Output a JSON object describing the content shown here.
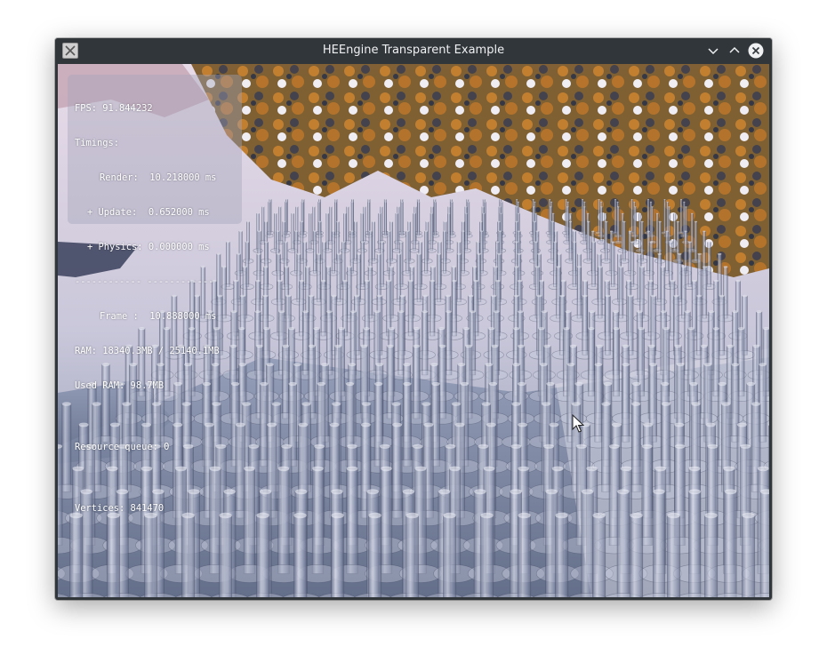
{
  "window": {
    "title": "HEEngine Transparent Example"
  },
  "stats": {
    "fps": "FPS: 91.844232",
    "timings_header": "Timings:",
    "render": "Render:  10.218000 ms",
    "update": "+ Update:  0.652000 ms",
    "physics": "+ Physics: 0.000000 ms",
    "separator": "------------ ------------",
    "frame": "Frame :  10.888000 ms",
    "ram": "RAM: 18340.3MB / 25140.1MB",
    "used_ram": "Used RAM: 98.7MB",
    "resource_queue": "Resource queue: 0",
    "vertices": "Vertices: 841470"
  },
  "icons": {
    "app": "app-icon",
    "minimize": "chevron-down-icon",
    "maximize": "chevron-up-icon",
    "close": "close-icon",
    "cursor": "mouse-pointer-icon"
  }
}
